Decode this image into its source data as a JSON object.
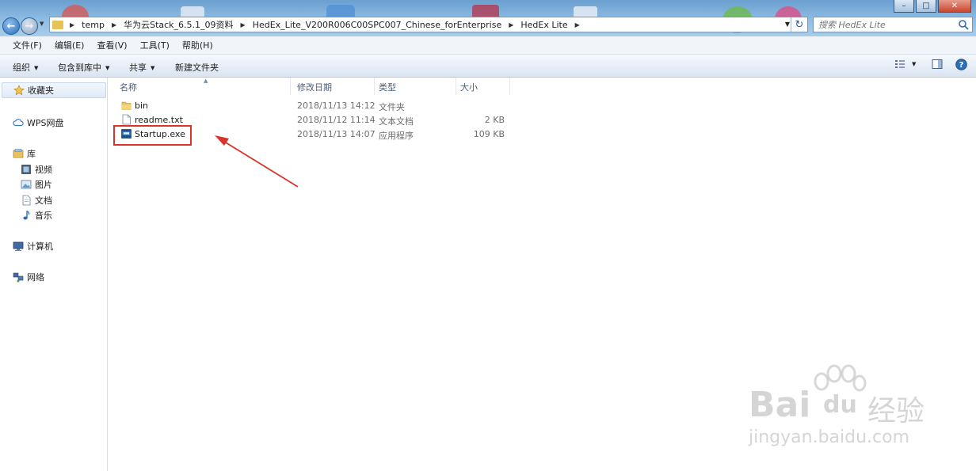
{
  "window": {
    "controls": {
      "minimize": "–",
      "maximize": "□",
      "close": "✕"
    }
  },
  "address": {
    "breadcrumbs": [
      "temp",
      "华为云Stack_6.5.1_09资料",
      "HedEx_Lite_V200R006C00SPC007_Chinese_forEnterprise",
      "HedEx Lite"
    ],
    "refresh": "↻"
  },
  "search": {
    "placeholder": "搜索 HedEx Lite"
  },
  "menu": [
    "文件(F)",
    "编辑(E)",
    "查看(V)",
    "工具(T)",
    "帮助(H)"
  ],
  "toolbar": {
    "organize": "组织",
    "include_in_library": "包含到库中",
    "share": "共享",
    "new_folder": "新建文件夹"
  },
  "sidebar": {
    "favorites": "收藏夹",
    "wps": "WPS网盘",
    "library": "库",
    "library_items": [
      "视频",
      "图片",
      "文档",
      "音乐"
    ],
    "computer": "计算机",
    "network": "网络"
  },
  "columns": {
    "name": "名称",
    "modified": "修改日期",
    "type": "类型",
    "size": "大小"
  },
  "files": [
    {
      "name": "bin",
      "modified": "2018/11/13 14:12",
      "type": "文件夹",
      "size": "",
      "icon": "folder-icon"
    },
    {
      "name": "readme.txt",
      "modified": "2018/11/12 11:14",
      "type": "文本文档",
      "size": "2 KB",
      "icon": "text-file-icon"
    },
    {
      "name": "Startup.exe",
      "modified": "2018/11/13 14:07",
      "type": "应用程序",
      "size": "109 KB",
      "icon": "exe-icon"
    }
  ],
  "annotation": {
    "color": "#d9332b"
  },
  "watermark": {
    "brand_latin": "Bai",
    "brand_du": "du",
    "brand_cn": "经验",
    "url": "jingyan.baidu.com"
  },
  "colors": {
    "accent": "#2a6fb7",
    "annotation": "#d9332b"
  }
}
